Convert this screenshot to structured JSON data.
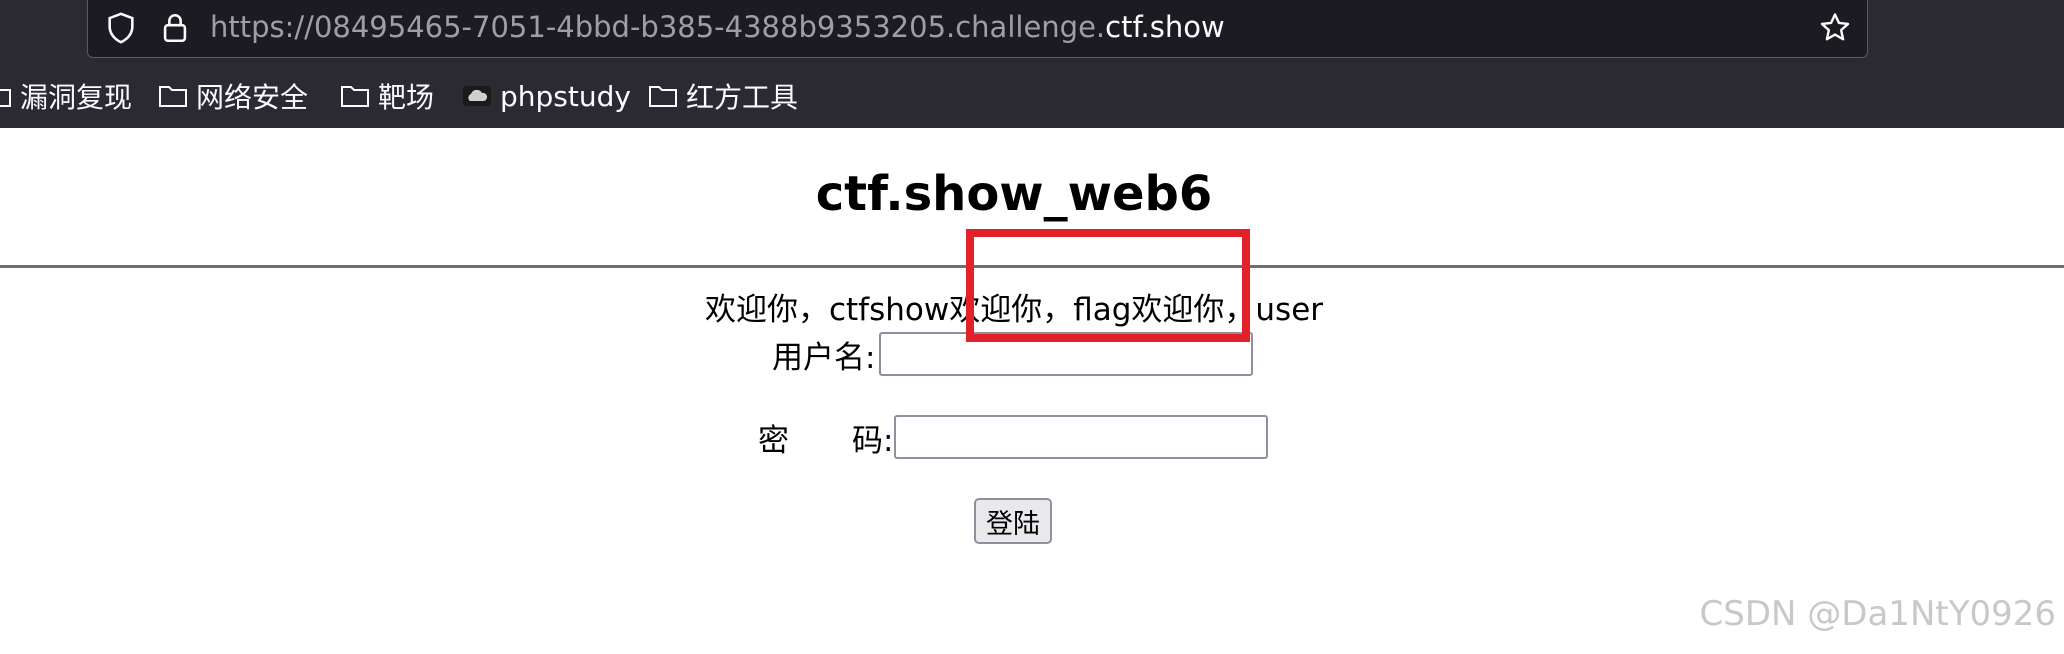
{
  "browser": {
    "url_prefix": "https://08495465-7051-4bbd-b385-4388b9353205.challenge.",
    "url_domain": "ctf.show",
    "colors": {
      "chrome": "#2b2a33",
      "urlbar": "#1c1b22"
    }
  },
  "bookmarks": [
    {
      "label": "漏洞复现",
      "icon": "folder-icon"
    },
    {
      "label": "网络安全",
      "icon": "folder-icon"
    },
    {
      "label": "靶场",
      "icon": "folder-icon"
    },
    {
      "label": "phpstudy",
      "icon": "cloud-icon"
    },
    {
      "label": "红方工具",
      "icon": "folder-icon"
    }
  ],
  "page": {
    "title": "ctf.show_web6",
    "welcome": "欢迎你，ctfshow欢迎你，flag欢迎你，user",
    "username_label": "用户名:",
    "password_label_1": "密",
    "password_label_2": "码:",
    "username_value": "",
    "password_value": "",
    "login_button": "登陆",
    "highlight_color": "#e2212a"
  },
  "watermark": "CSDN @Da1NtY0926"
}
